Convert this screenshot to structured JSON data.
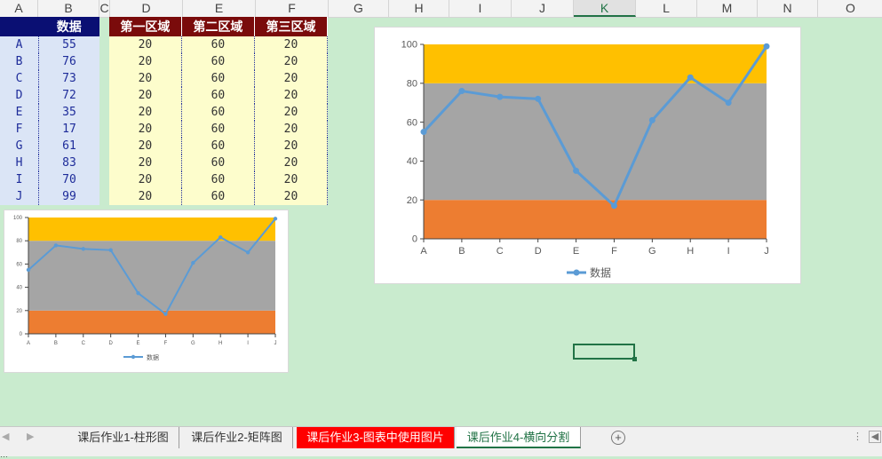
{
  "columns": [
    "A",
    "B",
    "C",
    "D",
    "E",
    "F",
    "G",
    "H",
    "I",
    "J",
    "K",
    "L",
    "M",
    "N",
    "O"
  ],
  "active_column": "K",
  "table1": {
    "header": "数据",
    "rows": [
      [
        "A",
        "55"
      ],
      [
        "B",
        "76"
      ],
      [
        "C",
        "73"
      ],
      [
        "D",
        "72"
      ],
      [
        "E",
        "35"
      ],
      [
        "F",
        "17"
      ],
      [
        "G",
        "61"
      ],
      [
        "H",
        "83"
      ],
      [
        "I",
        "70"
      ],
      [
        "J",
        "99"
      ]
    ]
  },
  "table2": {
    "headers": [
      "第一区域",
      "第二区域",
      "第三区域"
    ],
    "row": [
      "20",
      "60",
      "20"
    ],
    "row_count": 10
  },
  "chart_data": {
    "type": "line",
    "categories": [
      "A",
      "B",
      "C",
      "D",
      "E",
      "F",
      "G",
      "H",
      "I",
      "J"
    ],
    "series": [
      {
        "name": "数据",
        "values": [
          55,
          76,
          73,
          72,
          35,
          17,
          61,
          83,
          70,
          99
        ]
      }
    ],
    "bands": [
      {
        "from": 0,
        "to": 20,
        "color": "#ed7d31"
      },
      {
        "from": 20,
        "to": 80,
        "color": "#a5a5a5"
      },
      {
        "from": 80,
        "to": 100,
        "color": "#ffc000"
      }
    ],
    "ylim": [
      0,
      100
    ],
    "yticks": [
      "0",
      "20",
      "40",
      "60",
      "80",
      "100"
    ],
    "legend": "bottom",
    "line_color": "#5b9bd5"
  },
  "tabs": [
    {
      "label": "课后作业1-柱形图",
      "style": "normal"
    },
    {
      "label": "课后作业2-矩阵图",
      "style": "normal"
    },
    {
      "label": "课后作业3-图表中使用图片",
      "style": "red"
    },
    {
      "label": "课后作业4-横向分割",
      "style": "active"
    }
  ],
  "status_text": "…"
}
